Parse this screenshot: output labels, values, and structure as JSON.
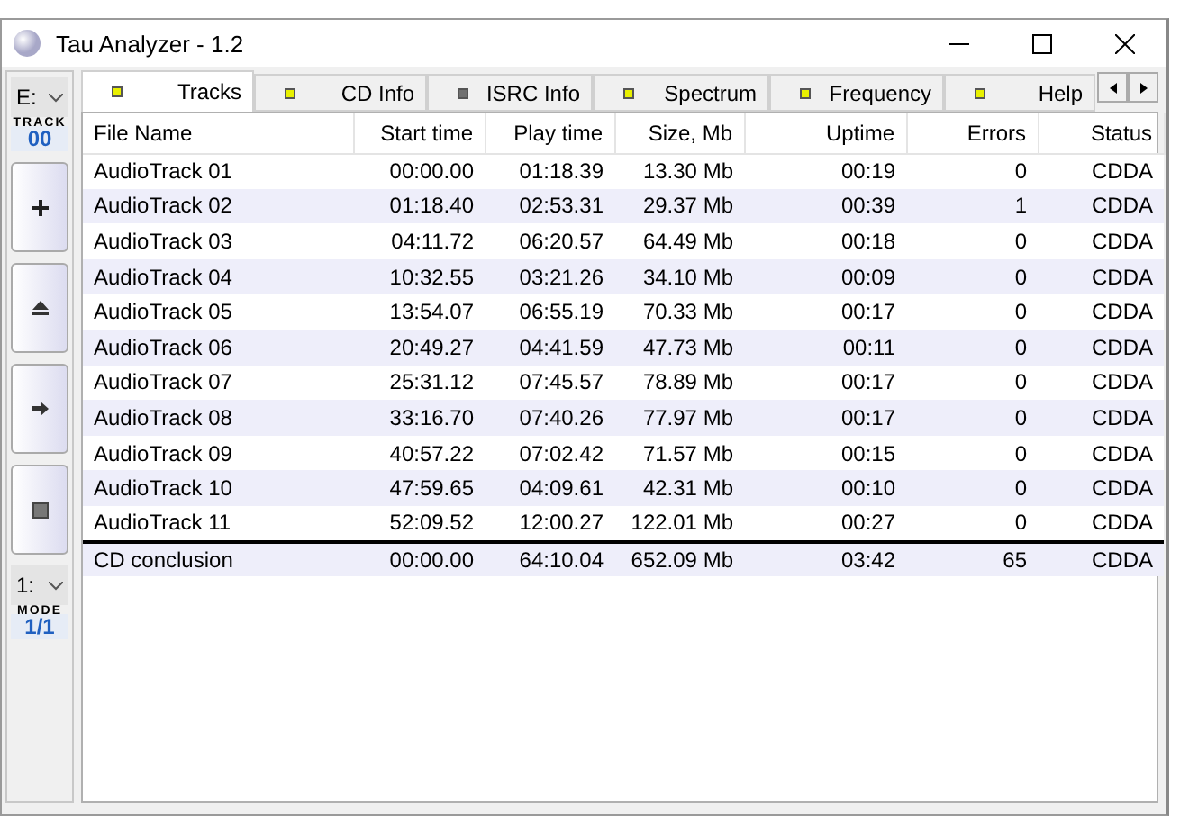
{
  "window": {
    "title": "Tau Analyzer - 1.2"
  },
  "side_panel": {
    "drive": "E:",
    "track_label": "TRACK",
    "track_number": "00",
    "mode_select": "1:",
    "mode_label": "MODE",
    "mode_value": "1/1"
  },
  "tabs": [
    {
      "label": "Tracks",
      "selected": true,
      "color": "#e8f000"
    },
    {
      "label": "CD Info",
      "selected": false,
      "color": "#e8f000"
    },
    {
      "label": "ISRC Info",
      "selected": false,
      "color": "#707070"
    },
    {
      "label": "Spectrum",
      "selected": false,
      "color": "#e8f000"
    },
    {
      "label": "Frequency",
      "selected": false,
      "color": "#e8f000"
    },
    {
      "label": "Help",
      "selected": false,
      "color": "#e8f000"
    }
  ],
  "table": {
    "columns": [
      "File Name",
      "Start time",
      "Play time",
      "Size, Mb",
      "Uptime",
      "Errors",
      "Status"
    ],
    "rows": [
      [
        "AudioTrack 01",
        "00:00.00",
        "01:18.39",
        "13.30 Mb",
        "00:19",
        "0",
        "CDDA"
      ],
      [
        "AudioTrack 02",
        "01:18.40",
        "02:53.31",
        "29.37 Mb",
        "00:39",
        "1",
        "CDDA"
      ],
      [
        "AudioTrack 03",
        "04:11.72",
        "06:20.57",
        "64.49 Mb",
        "00:18",
        "0",
        "CDDA"
      ],
      [
        "AudioTrack 04",
        "10:32.55",
        "03:21.26",
        "34.10 Mb",
        "00:09",
        "0",
        "CDDA"
      ],
      [
        "AudioTrack 05",
        "13:54.07",
        "06:55.19",
        "70.33 Mb",
        "00:17",
        "0",
        "CDDA"
      ],
      [
        "AudioTrack 06",
        "20:49.27",
        "04:41.59",
        "47.73 Mb",
        "00:11",
        "0",
        "CDDA"
      ],
      [
        "AudioTrack 07",
        "25:31.12",
        "07:45.57",
        "78.89 Mb",
        "00:17",
        "0",
        "CDDA"
      ],
      [
        "AudioTrack 08",
        "33:16.70",
        "07:40.26",
        "77.97 Mb",
        "00:17",
        "0",
        "CDDA"
      ],
      [
        "AudioTrack 09",
        "40:57.22",
        "07:02.42",
        "71.57 Mb",
        "00:15",
        "0",
        "CDDA"
      ],
      [
        "AudioTrack 10",
        "47:59.65",
        "04:09.61",
        "42.31 Mb",
        "00:10",
        "0",
        "CDDA"
      ],
      [
        "AudioTrack 11",
        "52:09.52",
        "12:00.27",
        "122.01 Mb",
        "00:27",
        "0",
        "CDDA"
      ]
    ],
    "summary": [
      "CD conclusion",
      "00:00.00",
      "64:10.04",
      "652.09 Mb",
      "03:42",
      "65",
      "CDDA"
    ]
  }
}
